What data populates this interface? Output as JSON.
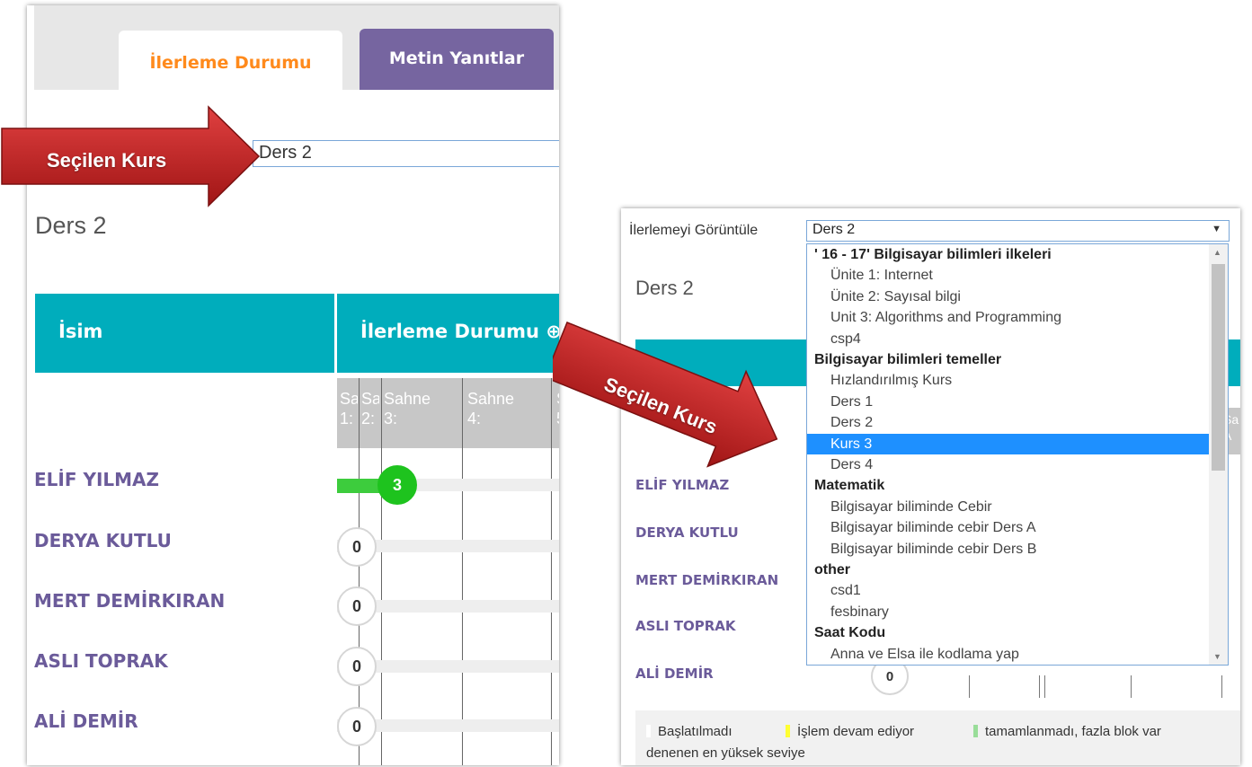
{
  "left": {
    "tabs": [
      {
        "label": "İlerleme Durumu",
        "active": true
      },
      {
        "label": "Metin Yanıtlar",
        "active": false
      }
    ],
    "course_select": "Ders 2",
    "title": "Ders 2",
    "header_name": "İsim",
    "header_progress": "İlerleme Durumu ⊕",
    "stages": [
      {
        "l1": "Sa",
        "l2": "1:"
      },
      {
        "l1": "Sa",
        "l2": "2:"
      },
      {
        "l1": "Sahne",
        "l2": "3:"
      },
      {
        "l1": "Sahne",
        "l2": "4:"
      },
      {
        "l1": "S",
        "l2": "5"
      }
    ],
    "students": [
      {
        "name": "ELİF YILMAZ",
        "progress": "3"
      },
      {
        "name": "DERYA KUTLU",
        "progress": "0"
      },
      {
        "name": "MERT DEMİRKIRAN",
        "progress": "0"
      },
      {
        "name": "ASLI TOPRAK",
        "progress": "0"
      },
      {
        "name": "ALİ DEMİR",
        "progress": "0"
      }
    ]
  },
  "right": {
    "view_label": "İlerlemeyi Görüntüle",
    "select_value": "Ders 2",
    "title": "Ders 2",
    "stage_partial": {
      "l1": "Sa",
      "l2": "A"
    },
    "students": [
      "ELİF YILMAZ",
      "DERYA KUTLU",
      "MERT DEMİRKIRAN",
      "ASLI TOPRAK",
      "ALİ DEMİR"
    ],
    "last_progress": "0",
    "legend": [
      {
        "label": "Başlatılmadı",
        "color": "#ffffff"
      },
      {
        "label": "İşlem devam ediyor",
        "color": "#ffff33"
      },
      {
        "label": "tamamlanmadı, fazla blok var",
        "color": "#99dd99"
      }
    ],
    "legend_line2": "denenen en yüksek seviye"
  },
  "dropdown": {
    "items": [
      {
        "type": "group",
        "label": "' 16 - 17' Bilgisayar bilimleri ilkeleri"
      },
      {
        "type": "option",
        "label": "Ünite 1: Internet"
      },
      {
        "type": "option",
        "label": "Ünite 2: Sayısal bilgi"
      },
      {
        "type": "option",
        "label": "Unit 3: Algorithms and Programming"
      },
      {
        "type": "option",
        "label": "csp4"
      },
      {
        "type": "group",
        "label": "Bilgisayar bilimleri temeller"
      },
      {
        "type": "option",
        "label": "Hızlandırılmış Kurs"
      },
      {
        "type": "option",
        "label": "Ders 1"
      },
      {
        "type": "option",
        "label": "Ders 2"
      },
      {
        "type": "option",
        "label": "Kurs 3",
        "selected": true
      },
      {
        "type": "option",
        "label": "Ders 4"
      },
      {
        "type": "group",
        "label": "Matematik"
      },
      {
        "type": "option",
        "label": "Bilgisayar biliminde Cebir"
      },
      {
        "type": "option",
        "label": "Bilgisayar biliminde cebir Ders A"
      },
      {
        "type": "option",
        "label": "Bilgisayar biliminde cebir Ders B"
      },
      {
        "type": "group",
        "label": "other"
      },
      {
        "type": "option",
        "label": "csd1"
      },
      {
        "type": "option",
        "label": "fesbinary"
      },
      {
        "type": "group",
        "label": "Saat Kodu"
      },
      {
        "type": "option",
        "label": "Anna ve Elsa ile kodlama yap"
      }
    ]
  },
  "callouts": {
    "left": "Seçilen Kurs",
    "right": "Seçilen Kurs",
    "color": "#c01f1f"
  }
}
